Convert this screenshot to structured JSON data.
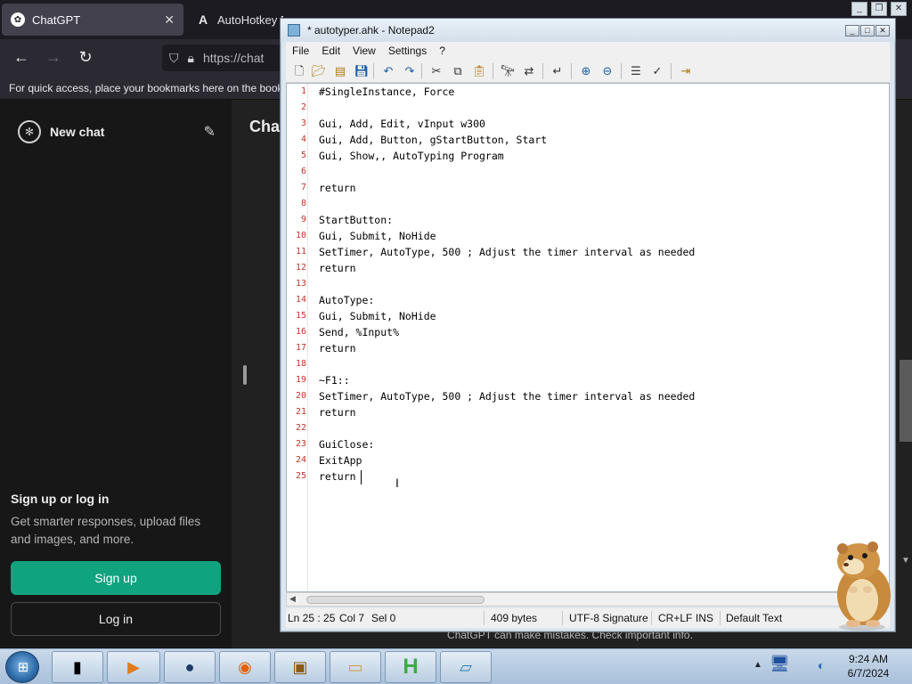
{
  "browser": {
    "tabs": [
      {
        "label": "ChatGPT",
        "active": true
      },
      {
        "label": "AutoHotkey D",
        "active": false
      }
    ],
    "url": "https://chat",
    "bookmarks_hint": "For quick access, place your bookmarks here on the book",
    "accent_color": "#10a37f"
  },
  "chatgpt": {
    "new_chat_label": "New chat",
    "main_title": "Chat",
    "signup_heading": "Sign up or log in",
    "signup_sub": "Get smarter responses, upload files and images, and more.",
    "signup_button": "Sign up",
    "login_button": "Log in",
    "footer_note": "ChatGPT can make mistakes. Check important info."
  },
  "notepad": {
    "title": "* autotyper.ahk - Notepad2",
    "menu": [
      "File",
      "Edit",
      "View",
      "Settings",
      "?"
    ],
    "toolbar_icons": [
      "new-icon",
      "open-icon",
      "browse-icon",
      "save-icon",
      "undo-icon",
      "redo-icon",
      "cut-icon",
      "copy-icon",
      "paste-icon",
      "find-icon",
      "replace-icon",
      "wordwrap-icon",
      "zoom-in-icon",
      "zoom-out-icon",
      "scheme-icon",
      "customize-icon",
      "exit-icon"
    ],
    "lines": [
      "#SingleInstance, Force",
      "",
      "Gui, Add, Edit, vInput w300",
      "Gui, Add, Button, gStartButton, Start",
      "Gui, Show,, AutoTyping Program",
      "",
      "return",
      "",
      "StartButton:",
      "Gui, Submit, NoHide",
      "SetTimer, AutoType, 500 ; Adjust the timer interval as needed",
      "return",
      "",
      "AutoType:",
      "Gui, Submit, NoHide",
      "Send, %Input%",
      "return",
      "",
      "~F1::",
      "SetTimer, AutoType, 500 ; Adjust the timer interval as needed",
      "return",
      "",
      "GuiClose:",
      "ExitApp",
      "return"
    ],
    "status": {
      "position": "Ln 25 : 25",
      "column": "Col 7",
      "selection": "Sel 0",
      "size": "409 bytes",
      "encoding": "UTF-8 Signature",
      "line_endings": "CR+LF",
      "mode": "INS",
      "scheme": "Default Text"
    }
  },
  "taskbar": {
    "items": [
      "terminal-app-icon",
      "media-player-icon",
      "browser-globe-icon",
      "firefox-icon",
      "box-game-icon",
      "file-explorer-icon",
      "h-app-icon",
      "notepad-app-icon"
    ],
    "time": "9:24 AM",
    "date": "6/7/2024"
  }
}
